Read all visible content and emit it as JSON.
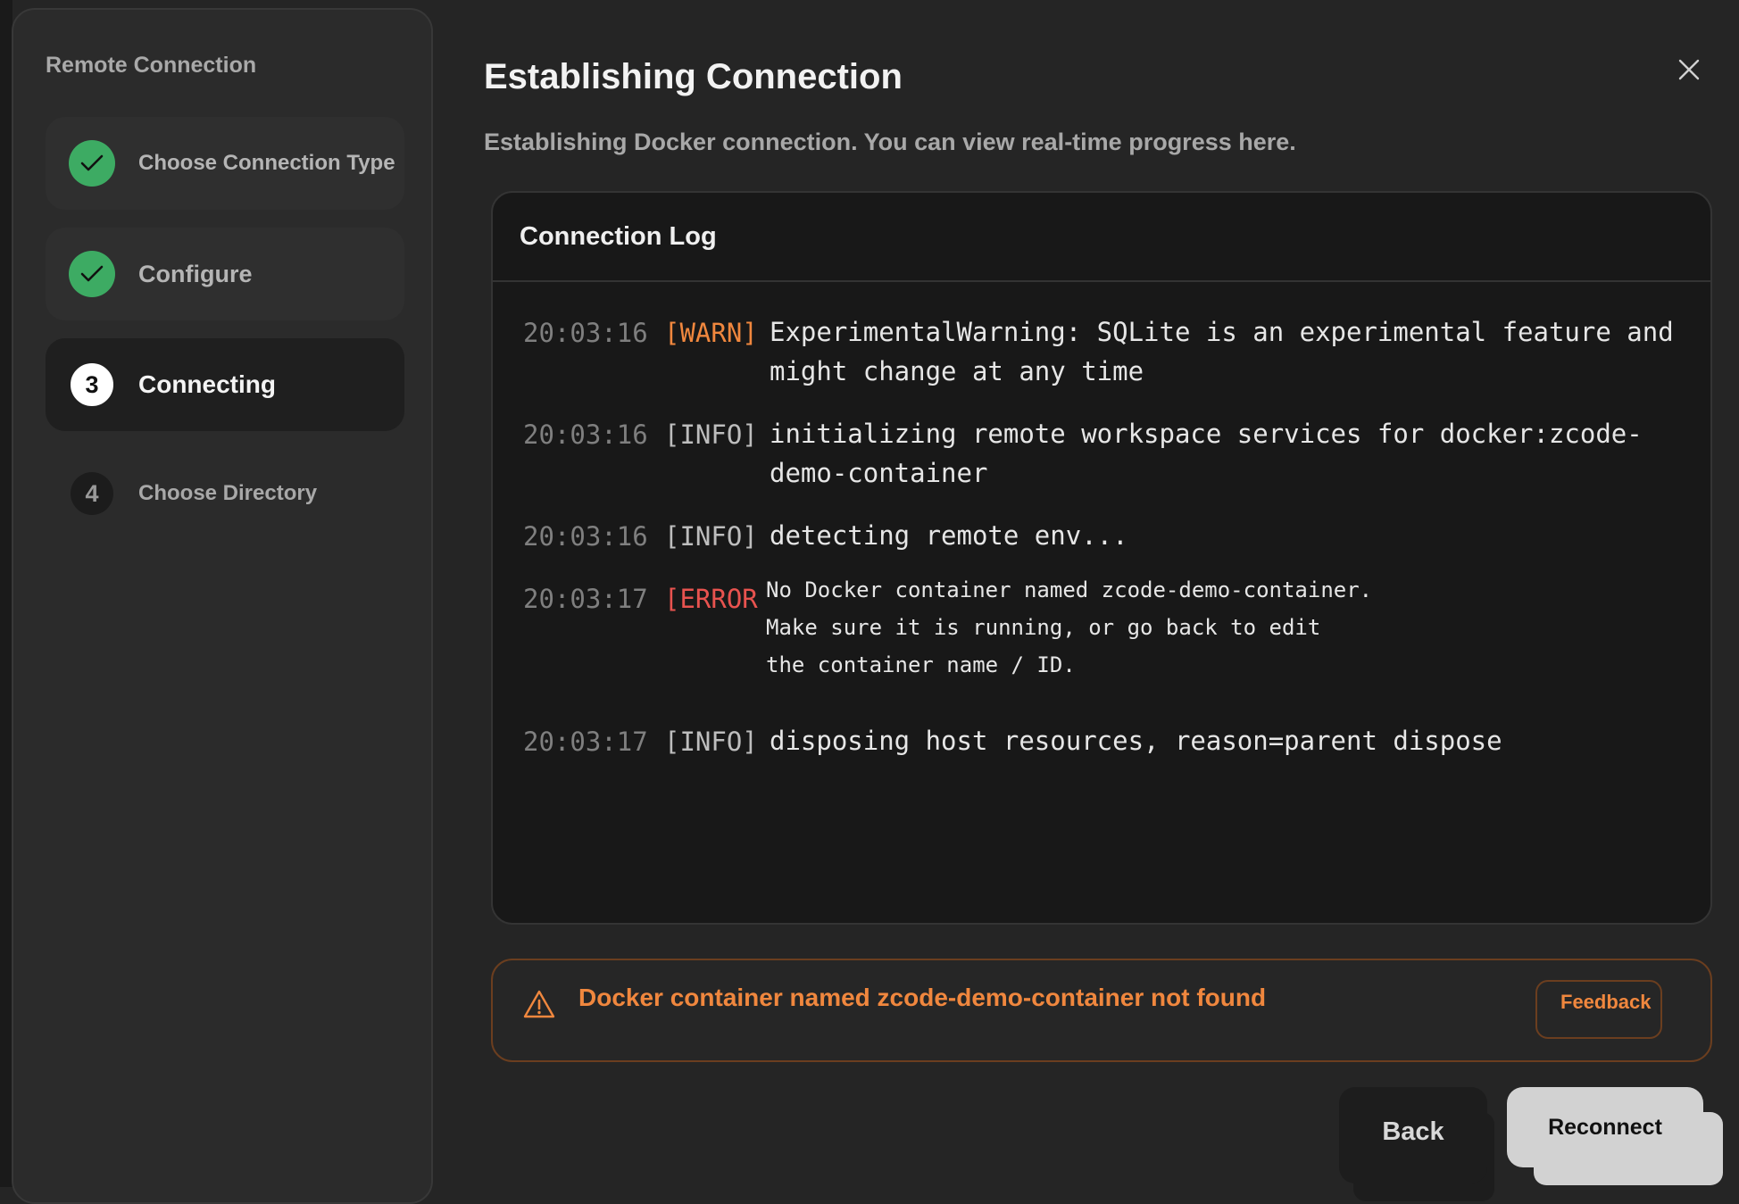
{
  "sidebar": {
    "title": "Remote Connection",
    "steps": [
      {
        "label": "Choose Connection Type",
        "number": "",
        "state": "done"
      },
      {
        "label": "Configure",
        "number": "",
        "state": "done"
      },
      {
        "label": "Connecting",
        "number": "3",
        "state": "active"
      },
      {
        "label": "Choose Directory",
        "number": "4",
        "state": "todo"
      }
    ]
  },
  "dialog": {
    "title": "Establishing Connection",
    "subtitle": "Establishing Docker connection. You can view real-time progress here."
  },
  "log": {
    "header": "Connection Log",
    "entries": [
      {
        "time": "20:03:16",
        "level": "[WARN]",
        "message": "ExperimentalWarning: SQLite is an experimental feature and\nmight change at any time"
      },
      {
        "time": "20:03:16",
        "level": "[INFO]",
        "message": "initializing remote workspace services for docker:zcode-\ndemo-container"
      },
      {
        "time": "20:03:16",
        "level": "[INFO]",
        "message": "detecting remote env..."
      },
      {
        "time": "20:03:17",
        "level": "[ERROR]",
        "message": "No Docker container named zcode-demo-container.\nMake sure it is running, or go back to edit\nthe container name / ID."
      },
      {
        "time": "20:03:17",
        "level": "[INFO]",
        "message": "disposing host resources, reason=parent dispose"
      }
    ]
  },
  "alert": {
    "message": "Docker container named zcode-demo-container not found",
    "feedback_label": "Feedback"
  },
  "buttons": {
    "back": "Back",
    "reconnect": "Reconnect"
  },
  "colors": {
    "success": "#3dab63",
    "warning": "#f0873e",
    "error": "#e8534f",
    "background": "#252525"
  }
}
